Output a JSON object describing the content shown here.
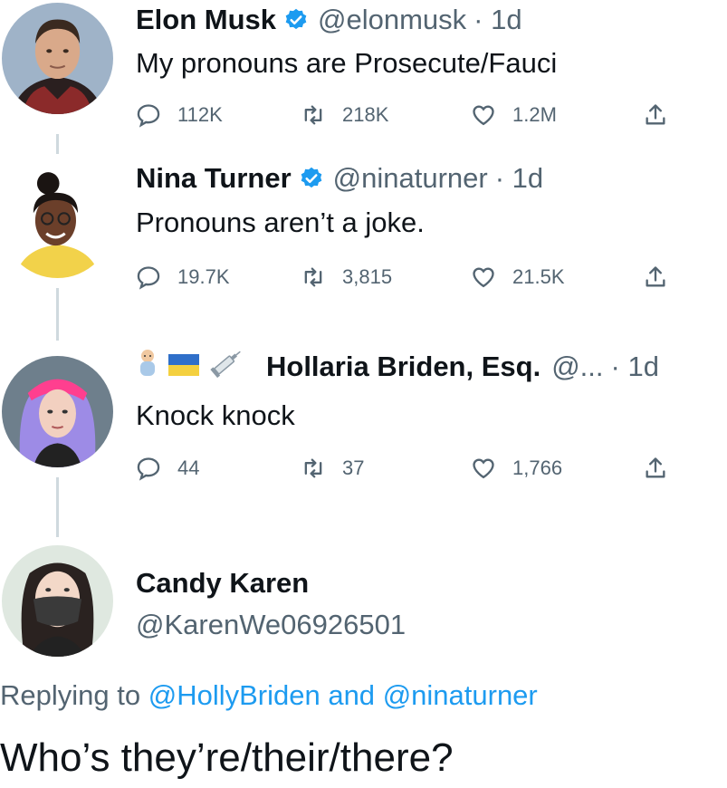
{
  "tweets": [
    {
      "name": "Elon Musk",
      "handle": "@elonmusk",
      "time": "· 1d",
      "text": "My pronouns are Prosecute/Fauci",
      "replies": "112K",
      "retweets": "218K",
      "likes": "1.2M"
    },
    {
      "name": "Nina Turner",
      "handle": "@ninaturner",
      "time": "· 1d",
      "text": "Pronouns aren’t a joke.",
      "replies": "19.7K",
      "retweets": "3,815",
      "likes": "21.5K"
    },
    {
      "name": "Hollaria Briden, Esq.",
      "handle": "@...",
      "time": "· 1d",
      "text": "Knock knock",
      "replies": "44",
      "retweets": "37",
      "likes": "1,766",
      "name_emojis": [
        "baby-icon",
        "ukraine-flag-icon",
        "syringe-icon"
      ]
    }
  ],
  "reply": {
    "name": "Candy Karen",
    "handle": "@KarenWe06926501",
    "replying_prefix": "Replying to",
    "mention_1": "@HollyBriden",
    "joiner": "and",
    "mention_2": "@ninaturner",
    "text": "Who’s they’re/their/there?"
  },
  "colors": {
    "accent": "#1d9bf0",
    "muted": "#536471",
    "text": "#0f1419",
    "thread_line": "#cfd9de"
  }
}
